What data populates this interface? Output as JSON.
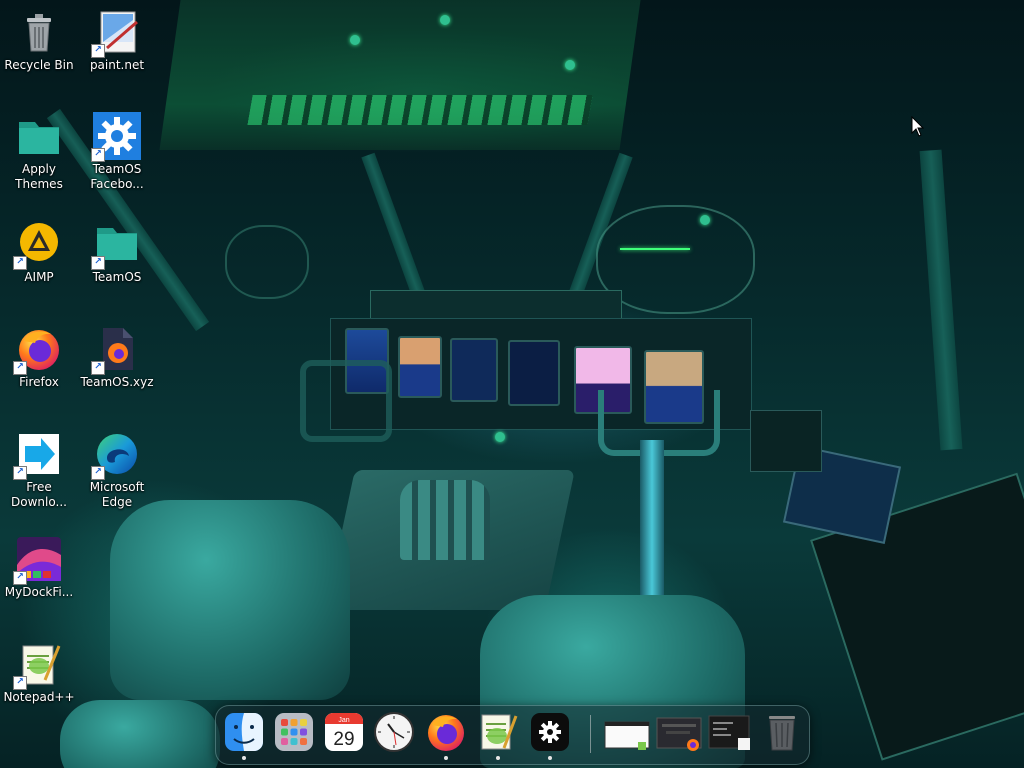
{
  "desktop": {
    "icons": [
      {
        "label": "Recycle Bin",
        "icon": "recycle-bin-icon"
      },
      {
        "label": "paint.net",
        "icon": "paint-net-icon"
      },
      {
        "label": "Apply Themes",
        "icon": "folder-icon"
      },
      {
        "label": "TeamOS Facebo...",
        "icon": "gear-icon"
      },
      {
        "label": "AIMP",
        "icon": "aimp-icon"
      },
      {
        "label": "TeamOS",
        "icon": "folder-icon"
      },
      {
        "label": "Firefox",
        "icon": "firefox-icon"
      },
      {
        "label": "TeamOS.xyz",
        "icon": "firefox-file-icon"
      },
      {
        "label": "Free Downlo...",
        "icon": "download-arrow-icon"
      },
      {
        "label": "Microsoft Edge",
        "icon": "edge-icon"
      },
      {
        "label": "MyDockFi...",
        "icon": "mydockfinder-icon"
      },
      {
        "label": "Notepad++",
        "icon": "notepad-plus-plus-icon"
      }
    ]
  },
  "dock": {
    "calendar_month": "Jan",
    "calendar_day": "29",
    "apps": [
      {
        "name": "finder",
        "running": true
      },
      {
        "name": "launchpad",
        "running": false
      },
      {
        "name": "calendar",
        "running": false
      },
      {
        "name": "clock",
        "running": false
      },
      {
        "name": "firefox",
        "running": true
      },
      {
        "name": "notepad-plus-plus",
        "running": true
      },
      {
        "name": "settings",
        "running": true
      }
    ],
    "windows": [
      "window-thumbnail-1",
      "window-thumbnail-2",
      "window-thumbnail-3"
    ],
    "trash": "trash"
  },
  "colors": {
    "dock_bg": "#14282d",
    "folder_teal": "#2bb5a0",
    "settings_blue": "#1f7fe0",
    "firefox_orange": "#ff7a1a"
  }
}
